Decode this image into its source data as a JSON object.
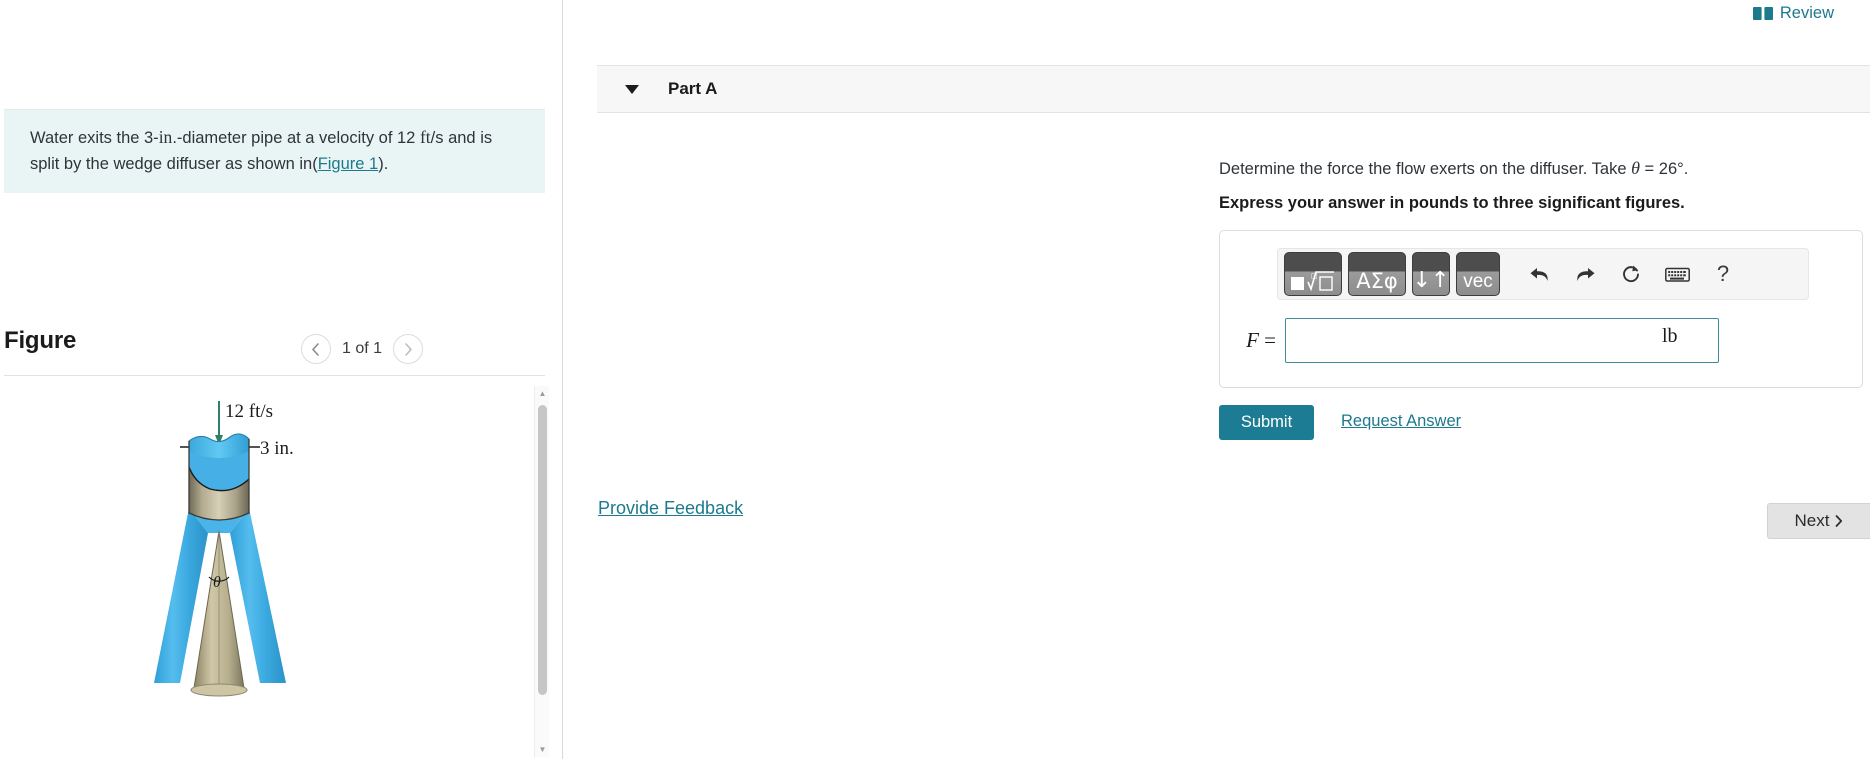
{
  "review": {
    "label": "Review",
    "icon": "book-icon",
    "color": "#1c7a8c"
  },
  "problem": {
    "text_part1": "Water exits the 3-",
    "unit_in": "in",
    "text_part2": ".-diameter pipe at a velocity of 12 ",
    "unit_fts": "ft",
    "text_part3": "/s and is split by the wedge diffuser as shown in(",
    "figure_link": "Figure 1",
    "text_part4": ").",
    "background": "#e9f5f4"
  },
  "figure": {
    "title": "Figure",
    "counter": "1 of 1",
    "prev_icon": "chevron-left-icon",
    "next_icon": "chevron-right-icon",
    "labels": {
      "velocity": "12 ft/s",
      "diameter": "3 in.",
      "angle": "θ"
    }
  },
  "part": {
    "label": "Part A",
    "caret_icon": "caret-down-icon",
    "question_pre": "Determine the force the flow exerts on the diffuser. Take ",
    "question_var": "θ",
    "question_post": " = 26°.",
    "instruction": "Express your answer in pounds to three significant figures."
  },
  "toolbar": {
    "buttons": [
      {
        "name": "template-sqrt-button",
        "glyph": "■√□"
      },
      {
        "name": "greek-symbols-button",
        "glyph": "ΑΣφ"
      },
      {
        "name": "arrows-button",
        "glyph": "↓↑"
      },
      {
        "name": "vector-button",
        "glyph": "vec"
      }
    ],
    "icons": [
      {
        "name": "undo-icon",
        "glyph": "↶"
      },
      {
        "name": "redo-icon",
        "glyph": "↷"
      },
      {
        "name": "reset-icon",
        "glyph": "↻"
      },
      {
        "name": "keyboard-icon",
        "glyph": "keyboard"
      },
      {
        "name": "help-icon",
        "glyph": "?"
      }
    ]
  },
  "answer": {
    "variable": "F",
    "equals": "=",
    "value": "",
    "placeholder": "",
    "unit": "lb",
    "border_color": "#3e8c96"
  },
  "actions": {
    "submit": "Submit",
    "request_answer": "Request Answer",
    "provide_feedback": "Provide Feedback",
    "next": "Next",
    "next_icon": "chevron-right-icon",
    "submit_color": "#1b7c94"
  }
}
